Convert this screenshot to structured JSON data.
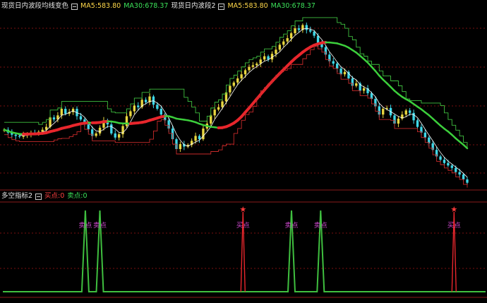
{
  "main_header": {
    "title1": "现货日内波段均线变色",
    "ma5": "MA5:583.80",
    "ma30": "MA30:678.37",
    "title2": "现货日内波段2"
  },
  "sub_header": {
    "title": "多空指标2",
    "buy_label": "买点:0",
    "sell_label": "卖点:0"
  },
  "colors": {
    "up": "#e8d740",
    "down": "#3fd8e8",
    "ma_up": "#e8262c",
    "ma_down": "#3ccf3c",
    "stop": "#c82a2a",
    "band": "#3fbf3f",
    "fast": "#ffffff",
    "grid": "#7a1010",
    "sell_mark": "#d04ad0",
    "buy_mark": "#ff3a3a"
  },
  "chart_data": [
    {
      "type": "candlestick",
      "series": [
        {
          "name": "现货日内波段均线变色",
          "note_key": "candles"
        }
      ],
      "close": [
        505,
        498,
        493,
        490,
        488,
        492,
        495,
        497,
        496,
        500,
        505,
        512,
        535,
        530,
        540,
        556,
        544,
        548,
        556,
        538,
        530,
        518,
        506,
        490,
        496,
        510,
        528,
        518,
        496,
        486,
        494,
        514,
        538,
        550,
        564,
        560,
        578,
        572,
        586,
        566,
        556,
        542,
        528,
        508,
        482,
        458,
        470,
        464,
        468,
        478,
        490,
        482,
        508,
        520,
        540,
        554,
        560,
        574,
        596,
        612,
        620,
        630,
        640,
        650,
        658,
        662,
        666,
        676,
        684,
        676,
        690,
        700,
        712,
        720,
        728,
        740,
        752,
        748,
        760,
        748,
        744,
        734,
        714,
        706,
        688,
        672,
        666,
        654,
        640,
        646,
        630,
        612,
        618,
        600,
        606,
        594,
        580,
        562,
        542,
        556,
        558,
        540,
        520,
        532,
        542,
        552,
        546,
        528,
        512,
        498,
        486,
        472,
        456,
        440,
        432,
        424,
        418,
        412,
        402,
        396,
        384,
        376
      ],
      "sample": "generated",
      "ylim": [
        360,
        790
      ]
    },
    {
      "type": "line",
      "series": [
        {
          "name": "买点",
          "peaks": [
            {
              "label": "买点"
            },
            {
              "label": "买点"
            }
          ]
        },
        {
          "name": "卖点",
          "peaks": [
            {
              "label": "卖点"
            },
            {
              "label": "卖点"
            },
            {
              "label": "卖点"
            },
            {
              "label": "卖点"
            }
          ]
        }
      ],
      "signal_indices": {
        "sell": [
          34,
          40,
          119,
          131
        ],
        "buy": [
          99,
          186
        ]
      },
      "ylim": [
        0,
        1
      ]
    }
  ]
}
